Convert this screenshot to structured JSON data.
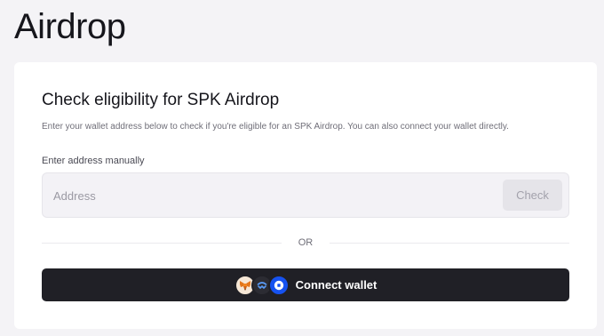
{
  "page": {
    "title": "Airdrop"
  },
  "card": {
    "title": "Check eligibility for SPK Airdrop",
    "description": "Enter your wallet address below to check if you're eligible for an SPK Airdrop. You can also connect your wallet directly.",
    "address_label": "Enter address manually",
    "address_placeholder": "Address",
    "address_value": "",
    "check_label": "Check",
    "divider_text": "OR",
    "connect_label": "Connect wallet",
    "wallet_icons": [
      "metamask-icon",
      "walletconnect-icon",
      "coinbase-wallet-icon"
    ]
  },
  "colors": {
    "background": "#f4f3f6",
    "card": "#ffffff",
    "connect_button": "#202026",
    "input_background": "#f3f2f6",
    "check_button": "#e5e4e9",
    "coinbase_blue": "#1652f0"
  }
}
